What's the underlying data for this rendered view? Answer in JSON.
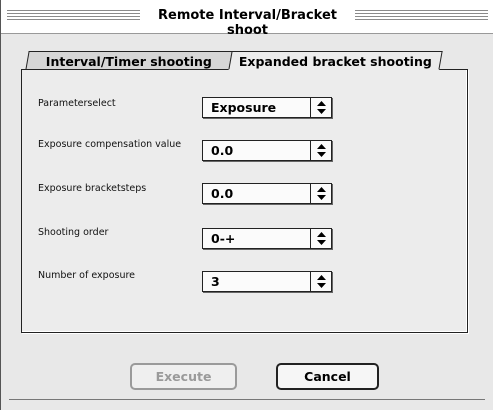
{
  "window": {
    "title": "Remote Interval/Bracket shoot"
  },
  "tabs": [
    {
      "label": "Interval/Timer shooting",
      "selected": false
    },
    {
      "label": "Expanded bracket shooting",
      "selected": true
    }
  ],
  "fields": [
    {
      "label": "Parameterselect",
      "value": "Exposure"
    },
    {
      "label": "Exposure compensation value",
      "value": "0.0"
    },
    {
      "label": "Exposure bracketsteps",
      "value": "0.0"
    },
    {
      "label": "Shooting order",
      "value": "0-+"
    },
    {
      "label": "Number of exposure",
      "value": "3"
    }
  ],
  "buttons": {
    "execute": "Execute",
    "cancel": "Cancel"
  },
  "icons": {
    "popup_arrows": "up-down-arrows-icon"
  }
}
